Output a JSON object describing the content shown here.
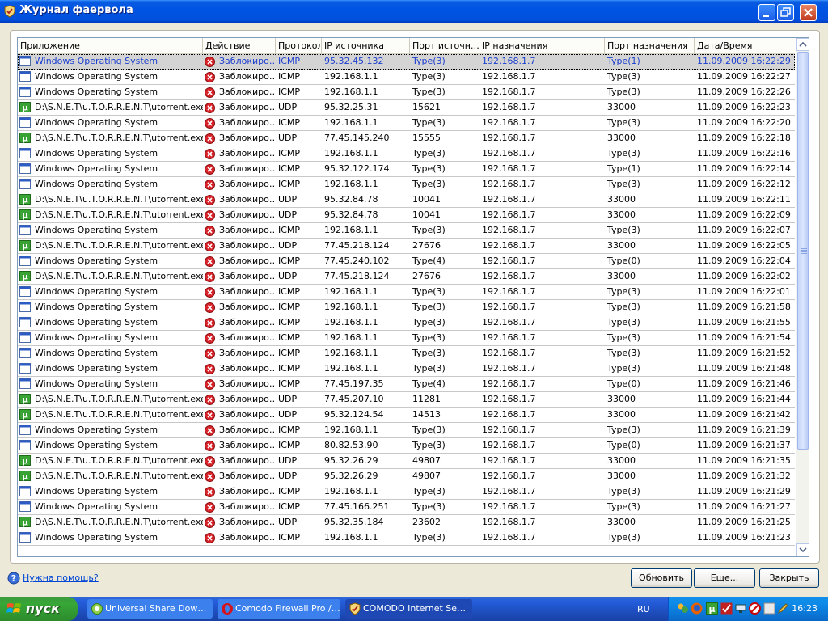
{
  "window": {
    "title": "Журнал фаервола"
  },
  "columns": [
    "Приложение",
    "Действие",
    "Протокол",
    "IP источника",
    "Порт источн…",
    "IP назначения",
    "Порт назначения",
    "Дата/Время"
  ],
  "rows": [
    {
      "app": "Windows Operating System",
      "app_type": "windows",
      "action": "Заблокиро…",
      "proto": "ICMP",
      "src_ip": "95.32.45.132",
      "src_port": "Type(3)",
      "dst_ip": "192.168.1.7",
      "dst_port": "Type(1)",
      "datetime": "11.09.2009 16:22:29",
      "selected": true
    },
    {
      "app": "Windows Operating System",
      "app_type": "windows",
      "action": "Заблокиро…",
      "proto": "ICMP",
      "src_ip": "192.168.1.1",
      "src_port": "Type(3)",
      "dst_ip": "192.168.1.7",
      "dst_port": "Type(3)",
      "datetime": "11.09.2009 16:22:27"
    },
    {
      "app": "Windows Operating System",
      "app_type": "windows",
      "action": "Заблокиро…",
      "proto": "ICMP",
      "src_ip": "192.168.1.1",
      "src_port": "Type(3)",
      "dst_ip": "192.168.1.7",
      "dst_port": "Type(3)",
      "datetime": "11.09.2009 16:22:26"
    },
    {
      "app": "D:\\S.N.E.T\\u.T.O.R.R.E.N.T\\utorrent.exe",
      "app_type": "torrent",
      "action": "Заблокиро…",
      "proto": "UDP",
      "src_ip": "95.32.25.31",
      "src_port": "15621",
      "dst_ip": "192.168.1.7",
      "dst_port": "33000",
      "datetime": "11.09.2009 16:22:23"
    },
    {
      "app": "Windows Operating System",
      "app_type": "windows",
      "action": "Заблокиро…",
      "proto": "ICMP",
      "src_ip": "192.168.1.1",
      "src_port": "Type(3)",
      "dst_ip": "192.168.1.7",
      "dst_port": "Type(3)",
      "datetime": "11.09.2009 16:22:20"
    },
    {
      "app": "D:\\S.N.E.T\\u.T.O.R.R.E.N.T\\utorrent.exe",
      "app_type": "torrent",
      "action": "Заблокиро…",
      "proto": "UDP",
      "src_ip": "77.45.145.240",
      "src_port": "15555",
      "dst_ip": "192.168.1.7",
      "dst_port": "33000",
      "datetime": "11.09.2009 16:22:18"
    },
    {
      "app": "Windows Operating System",
      "app_type": "windows",
      "action": "Заблокиро…",
      "proto": "ICMP",
      "src_ip": "192.168.1.1",
      "src_port": "Type(3)",
      "dst_ip": "192.168.1.7",
      "dst_port": "Type(3)",
      "datetime": "11.09.2009 16:22:16"
    },
    {
      "app": "Windows Operating System",
      "app_type": "windows",
      "action": "Заблокиро…",
      "proto": "ICMP",
      "src_ip": "95.32.122.174",
      "src_port": "Type(3)",
      "dst_ip": "192.168.1.7",
      "dst_port": "Type(1)",
      "datetime": "11.09.2009 16:22:14"
    },
    {
      "app": "Windows Operating System",
      "app_type": "windows",
      "action": "Заблокиро…",
      "proto": "ICMP",
      "src_ip": "192.168.1.1",
      "src_port": "Type(3)",
      "dst_ip": "192.168.1.7",
      "dst_port": "Type(3)",
      "datetime": "11.09.2009 16:22:12"
    },
    {
      "app": "D:\\S.N.E.T\\u.T.O.R.R.E.N.T\\utorrent.exe",
      "app_type": "torrent",
      "action": "Заблокиро…",
      "proto": "UDP",
      "src_ip": "95.32.84.78",
      "src_port": "10041",
      "dst_ip": "192.168.1.7",
      "dst_port": "33000",
      "datetime": "11.09.2009 16:22:11"
    },
    {
      "app": "D:\\S.N.E.T\\u.T.O.R.R.E.N.T\\utorrent.exe",
      "app_type": "torrent",
      "action": "Заблокиро…",
      "proto": "UDP",
      "src_ip": "95.32.84.78",
      "src_port": "10041",
      "dst_ip": "192.168.1.7",
      "dst_port": "33000",
      "datetime": "11.09.2009 16:22:09"
    },
    {
      "app": "Windows Operating System",
      "app_type": "windows",
      "action": "Заблокиро…",
      "proto": "ICMP",
      "src_ip": "192.168.1.1",
      "src_port": "Type(3)",
      "dst_ip": "192.168.1.7",
      "dst_port": "Type(3)",
      "datetime": "11.09.2009 16:22:07"
    },
    {
      "app": "D:\\S.N.E.T\\u.T.O.R.R.E.N.T\\utorrent.exe",
      "app_type": "torrent",
      "action": "Заблокиро…",
      "proto": "UDP",
      "src_ip": "77.45.218.124",
      "src_port": "27676",
      "dst_ip": "192.168.1.7",
      "dst_port": "33000",
      "datetime": "11.09.2009 16:22:05"
    },
    {
      "app": "Windows Operating System",
      "app_type": "windows",
      "action": "Заблокиро…",
      "proto": "ICMP",
      "src_ip": "77.45.240.102",
      "src_port": "Type(4)",
      "dst_ip": "192.168.1.7",
      "dst_port": "Type(0)",
      "datetime": "11.09.2009 16:22:04"
    },
    {
      "app": "D:\\S.N.E.T\\u.T.O.R.R.E.N.T\\utorrent.exe",
      "app_type": "torrent",
      "action": "Заблокиро…",
      "proto": "UDP",
      "src_ip": "77.45.218.124",
      "src_port": "27676",
      "dst_ip": "192.168.1.7",
      "dst_port": "33000",
      "datetime": "11.09.2009 16:22:02"
    },
    {
      "app": "Windows Operating System",
      "app_type": "windows",
      "action": "Заблокиро…",
      "proto": "ICMP",
      "src_ip": "192.168.1.1",
      "src_port": "Type(3)",
      "dst_ip": "192.168.1.7",
      "dst_port": "Type(3)",
      "datetime": "11.09.2009 16:22:01"
    },
    {
      "app": "Windows Operating System",
      "app_type": "windows",
      "action": "Заблокиро…",
      "proto": "ICMP",
      "src_ip": "192.168.1.1",
      "src_port": "Type(3)",
      "dst_ip": "192.168.1.7",
      "dst_port": "Type(3)",
      "datetime": "11.09.2009 16:21:58"
    },
    {
      "app": "Windows Operating System",
      "app_type": "windows",
      "action": "Заблокиро…",
      "proto": "ICMP",
      "src_ip": "192.168.1.1",
      "src_port": "Type(3)",
      "dst_ip": "192.168.1.7",
      "dst_port": "Type(3)",
      "datetime": "11.09.2009 16:21:55"
    },
    {
      "app": "Windows Operating System",
      "app_type": "windows",
      "action": "Заблокиро…",
      "proto": "ICMP",
      "src_ip": "192.168.1.1",
      "src_port": "Type(3)",
      "dst_ip": "192.168.1.7",
      "dst_port": "Type(3)",
      "datetime": "11.09.2009 16:21:54"
    },
    {
      "app": "Windows Operating System",
      "app_type": "windows",
      "action": "Заблокиро…",
      "proto": "ICMP",
      "src_ip": "192.168.1.1",
      "src_port": "Type(3)",
      "dst_ip": "192.168.1.7",
      "dst_port": "Type(3)",
      "datetime": "11.09.2009 16:21:52"
    },
    {
      "app": "Windows Operating System",
      "app_type": "windows",
      "action": "Заблокиро…",
      "proto": "ICMP",
      "src_ip": "192.168.1.1",
      "src_port": "Type(3)",
      "dst_ip": "192.168.1.7",
      "dst_port": "Type(3)",
      "datetime": "11.09.2009 16:21:48"
    },
    {
      "app": "Windows Operating System",
      "app_type": "windows",
      "action": "Заблокиро…",
      "proto": "ICMP",
      "src_ip": "77.45.197.35",
      "src_port": "Type(4)",
      "dst_ip": "192.168.1.7",
      "dst_port": "Type(0)",
      "datetime": "11.09.2009 16:21:46"
    },
    {
      "app": "D:\\S.N.E.T\\u.T.O.R.R.E.N.T\\utorrent.exe",
      "app_type": "torrent",
      "action": "Заблокиро…",
      "proto": "UDP",
      "src_ip": "77.45.207.10",
      "src_port": "11281",
      "dst_ip": "192.168.1.7",
      "dst_port": "33000",
      "datetime": "11.09.2009 16:21:44"
    },
    {
      "app": "D:\\S.N.E.T\\u.T.O.R.R.E.N.T\\utorrent.exe",
      "app_type": "torrent",
      "action": "Заблокиро…",
      "proto": "UDP",
      "src_ip": "95.32.124.54",
      "src_port": "14513",
      "dst_ip": "192.168.1.7",
      "dst_port": "33000",
      "datetime": "11.09.2009 16:21:42"
    },
    {
      "app": "Windows Operating System",
      "app_type": "windows",
      "action": "Заблокиро…",
      "proto": "ICMP",
      "src_ip": "192.168.1.1",
      "src_port": "Type(3)",
      "dst_ip": "192.168.1.7",
      "dst_port": "Type(3)",
      "datetime": "11.09.2009 16:21:39"
    },
    {
      "app": "Windows Operating System",
      "app_type": "windows",
      "action": "Заблокиро…",
      "proto": "ICMP",
      "src_ip": "80.82.53.90",
      "src_port": "Type(3)",
      "dst_ip": "192.168.1.7",
      "dst_port": "Type(0)",
      "datetime": "11.09.2009 16:21:37"
    },
    {
      "app": "D:\\S.N.E.T\\u.T.O.R.R.E.N.T\\utorrent.exe",
      "app_type": "torrent",
      "action": "Заблокиро…",
      "proto": "UDP",
      "src_ip": "95.32.26.29",
      "src_port": "49807",
      "dst_ip": "192.168.1.7",
      "dst_port": "33000",
      "datetime": "11.09.2009 16:21:35"
    },
    {
      "app": "D:\\S.N.E.T\\u.T.O.R.R.E.N.T\\utorrent.exe",
      "app_type": "torrent",
      "action": "Заблокиро…",
      "proto": "UDP",
      "src_ip": "95.32.26.29",
      "src_port": "49807",
      "dst_ip": "192.168.1.7",
      "dst_port": "33000",
      "datetime": "11.09.2009 16:21:32"
    },
    {
      "app": "Windows Operating System",
      "app_type": "windows",
      "action": "Заблокиро…",
      "proto": "ICMP",
      "src_ip": "192.168.1.1",
      "src_port": "Type(3)",
      "dst_ip": "192.168.1.7",
      "dst_port": "Type(3)",
      "datetime": "11.09.2009 16:21:29"
    },
    {
      "app": "Windows Operating System",
      "app_type": "windows",
      "action": "Заблокиро…",
      "proto": "ICMP",
      "src_ip": "77.45.166.251",
      "src_port": "Type(3)",
      "dst_ip": "192.168.1.7",
      "dst_port": "Type(3)",
      "datetime": "11.09.2009 16:21:27"
    },
    {
      "app": "D:\\S.N.E.T\\u.T.O.R.R.E.N.T\\utorrent.exe",
      "app_type": "torrent",
      "action": "Заблокиро…",
      "proto": "UDP",
      "src_ip": "95.32.35.184",
      "src_port": "23602",
      "dst_ip": "192.168.1.7",
      "dst_port": "33000",
      "datetime": "11.09.2009 16:21:25"
    },
    {
      "app": "Windows Operating System",
      "app_type": "windows",
      "action": "Заблокиро…",
      "proto": "ICMP",
      "src_ip": "192.168.1.1",
      "src_port": "Type(3)",
      "dst_ip": "192.168.1.7",
      "dst_port": "Type(3)",
      "datetime": "11.09.2009 16:21:23"
    }
  ],
  "footer": {
    "help_link": "Нужна помощь?",
    "refresh_label": "Обновить",
    "more_label": "Еще...",
    "close_label": "Закрыть"
  },
  "taskbar": {
    "start_label": "пуск",
    "tasks": [
      {
        "label": "Universal Share Dow…",
        "icon": "share-icon",
        "active": false
      },
      {
        "label": "Comodo Firewall Pro /…",
        "icon": "opera-icon",
        "active": false
      },
      {
        "label": "COMODO Internet Se…",
        "icon": "comodo-shield-icon",
        "active": true
      }
    ],
    "language": "RU",
    "clock": "16:23",
    "tray_icons": [
      "messenger-icon",
      "firefox-icon",
      "utorrent-icon",
      "comodo-tray-icon",
      "network-icon",
      "antivirus-icon",
      "volume-icon",
      "pencil-icon"
    ]
  },
  "colors": {
    "titlebar": "#0054e3",
    "selected_text": "#1c3fd0",
    "blocked_icon": "#d8232a",
    "torrent_icon": "#3aa335",
    "link": "#0046d5"
  }
}
